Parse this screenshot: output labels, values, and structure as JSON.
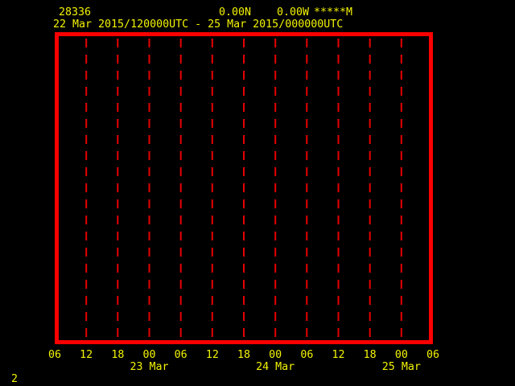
{
  "colors": {
    "background": "#000000",
    "text": "#f2f200",
    "frame": "#fb0000",
    "grid": "#e80000"
  },
  "header": {
    "station_id": "28336",
    "latitude": "0.00N",
    "longitude": "0.00W",
    "elevation": "*****M",
    "time_range": "22 Mar 2015/120000UTC - 25 Mar 2015/000000UTC"
  },
  "page_number": "2",
  "chart_data": {
    "type": "line",
    "title": "",
    "description": "Empty meteogram time-series frame: red bordered plot area with dashed vertical time gridlines, no data series plotted",
    "x_axis": {
      "tick_labels": [
        "06",
        "12",
        "18",
        "00",
        "06",
        "12",
        "18",
        "00",
        "06",
        "12",
        "18",
        "00",
        "06"
      ],
      "tick_interval_hours": 6,
      "date_labels": [
        {
          "label": "23 Mar",
          "tick_index": 3
        },
        {
          "label": "24 Mar",
          "tick_index": 7
        },
        {
          "label": "25 Mar",
          "tick_index": 11
        }
      ]
    },
    "y_axis": {
      "tick_labels": []
    },
    "series": [],
    "grid": {
      "orientation": "vertical",
      "style": "dashed",
      "color": "#e80000"
    },
    "legend": null
  }
}
